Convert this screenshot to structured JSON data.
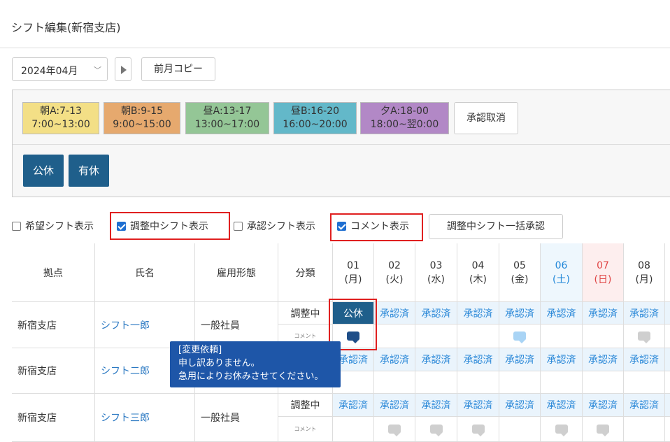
{
  "page": {
    "title": "シフト編集(新宿支店)"
  },
  "toolbar": {
    "month_value": "2024年04月",
    "copy_label": "前月コピー"
  },
  "shift_types": [
    {
      "name": "朝A:7-13",
      "time": "7:00~13:00",
      "color": "#f3df86"
    },
    {
      "name": "朝B:9-15",
      "time": "9:00~15:00",
      "color": "#e6a96e"
    },
    {
      "name": "昼A:13-17",
      "time": "13:00~17:00",
      "color": "#94c696"
    },
    {
      "name": "昼B:16-20",
      "time": "16:00~20:00",
      "color": "#63b8c9"
    },
    {
      "name": "夕A:18-00",
      "time": "18:00~翌0:00",
      "color": "#b288c6"
    }
  ],
  "cancel_approval_label": "承認取消",
  "leave_types": [
    "公休",
    "有休"
  ],
  "options": {
    "wish": "希望シフト表示",
    "adjusting": "調整中シフト表示",
    "approved": "承認シフト表示",
    "comment": "コメント表示",
    "bulk_approve": "調整中シフト一括承認"
  },
  "table": {
    "headers": {
      "base": "拠点",
      "name": "氏名",
      "employment": "雇用形態",
      "category": "分類"
    },
    "days": [
      {
        "num": "01",
        "dow": "(月)",
        "type": "weekday"
      },
      {
        "num": "02",
        "dow": "(火)",
        "type": "weekday"
      },
      {
        "num": "03",
        "dow": "(水)",
        "type": "weekday"
      },
      {
        "num": "04",
        "dow": "(木)",
        "type": "weekday"
      },
      {
        "num": "05",
        "dow": "(金)",
        "type": "weekday"
      },
      {
        "num": "06",
        "dow": "(土)",
        "type": "sat"
      },
      {
        "num": "07",
        "dow": "(日)",
        "type": "sun"
      },
      {
        "num": "08",
        "dow": "(月)",
        "type": "weekday"
      }
    ],
    "rows": [
      {
        "base": "新宿支店",
        "name": "シフト一郎",
        "employment": "一般社員",
        "adjust_label": "調整中",
        "comment_label": "コメント",
        "adjust": [
          "公休",
          "承認済",
          "承認済",
          "承認済",
          "承認済",
          "承認済",
          "承認済",
          "承認済"
        ],
        "comments": [
          "dark",
          "",
          "",
          "",
          "light",
          "",
          "",
          "grey"
        ]
      },
      {
        "base": "新宿支店",
        "name": "シフト二郎",
        "employment": "",
        "adjust_label": "",
        "comment_label": "",
        "adjust": [
          "承認済",
          "承認済",
          "承認済",
          "承認済",
          "承認済",
          "承認済",
          "承認済",
          "承認済"
        ],
        "comments": [
          "",
          "",
          "",
          "",
          "",
          "",
          "",
          ""
        ]
      },
      {
        "base": "新宿支店",
        "name": "シフト三郎",
        "employment": "一般社員",
        "adjust_label": "調整中",
        "comment_label": "コメント",
        "adjust": [
          "承認済",
          "承認済",
          "承認済",
          "承認済",
          "承認済",
          "承認済",
          "承認済",
          "承認済"
        ],
        "comments": [
          "",
          "grey",
          "grey",
          "grey",
          "",
          "grey",
          "grey",
          ""
        ]
      }
    ]
  },
  "tooltip": {
    "title": "[変更依頼]",
    "line1": "申し訳ありません。",
    "line2": "急用によりお休みさせてください。"
  }
}
